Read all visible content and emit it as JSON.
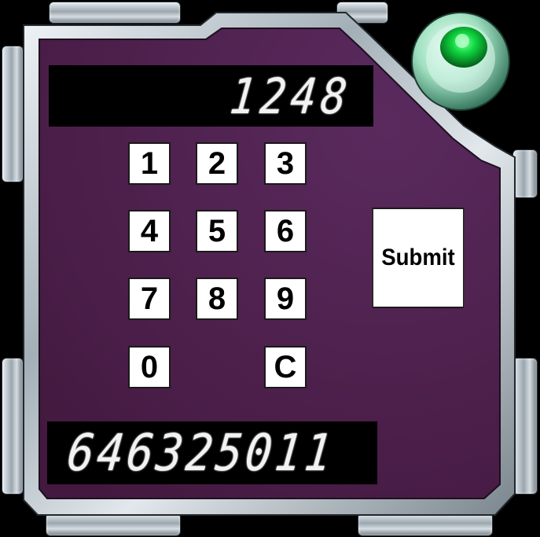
{
  "top_display": {
    "value": "1248"
  },
  "bottom_display": {
    "value": "646325011"
  },
  "keypad": {
    "keys": [
      "1",
      "2",
      "3",
      "4",
      "5",
      "6",
      "7",
      "8",
      "9",
      "0",
      "C"
    ]
  },
  "submit_button": {
    "label": "Submit"
  },
  "indicator": {
    "icon": "green-status-light-icon",
    "color": "#00e840"
  },
  "colors": {
    "panel": "#4b1f4f",
    "frame": "#c9d2d8",
    "display_bg": "#000000",
    "display_text": "#f2f2f2",
    "key_bg": "#ffffff"
  }
}
